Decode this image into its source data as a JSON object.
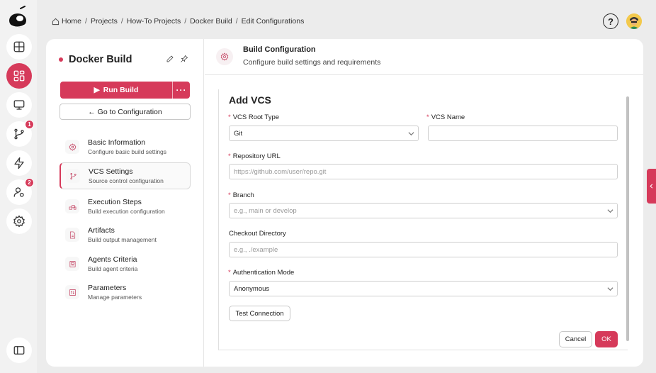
{
  "rail": {
    "badges": {
      "branches": "1",
      "users": "2"
    }
  },
  "breadcrumb": [
    "Home",
    "Projects",
    "How-To Projects",
    "Docker Build",
    "Edit Configurations"
  ],
  "breadcrumb_sep": "/",
  "header": {
    "help_label": "?"
  },
  "project": {
    "name": "Docker Build"
  },
  "buttons": {
    "run_build": "Run Build",
    "more": "···",
    "goto_config": "← Go to Configuration"
  },
  "nav": [
    {
      "title": "Basic Information",
      "subtitle": "Configure basic build settings",
      "icon": "gear-icon"
    },
    {
      "title": "VCS Settings",
      "subtitle": "Source control configuration",
      "icon": "branch-icon"
    },
    {
      "title": "Execution Steps",
      "subtitle": "Build execution configuration",
      "icon": "steps-icon"
    },
    {
      "title": "Artifacts",
      "subtitle": "Build output management",
      "icon": "file-icon"
    },
    {
      "title": "Agents Criteria",
      "subtitle": "Build agent criteria",
      "icon": "agent-icon"
    },
    {
      "title": "Parameters",
      "subtitle": "Manage parameters",
      "icon": "params-icon"
    }
  ],
  "section": {
    "title": "Build Configuration",
    "subtitle": "Configure build settings and requirements"
  },
  "form": {
    "title": "Add VCS",
    "vcs_root_type": {
      "label": "VCS Root Type",
      "value": "Git"
    },
    "vcs_name": {
      "label": "VCS Name",
      "value": ""
    },
    "repository_url": {
      "label": "Repository URL",
      "placeholder": "https://github.com/user/repo.git"
    },
    "branch": {
      "label": "Branch",
      "placeholder": "e.g., main or develop"
    },
    "checkout_directory": {
      "label": "Checkout Directory",
      "placeholder": "e.g., ./example"
    },
    "auth_mode": {
      "label": "Authentication Mode",
      "value": "Anonymous"
    },
    "required_mark": "*",
    "test_connection": "Test Connection",
    "cancel": "Cancel",
    "ok": "OK"
  },
  "colors": {
    "accent": "#d63a5a",
    "background": "#ececec",
    "card": "#ffffff"
  }
}
